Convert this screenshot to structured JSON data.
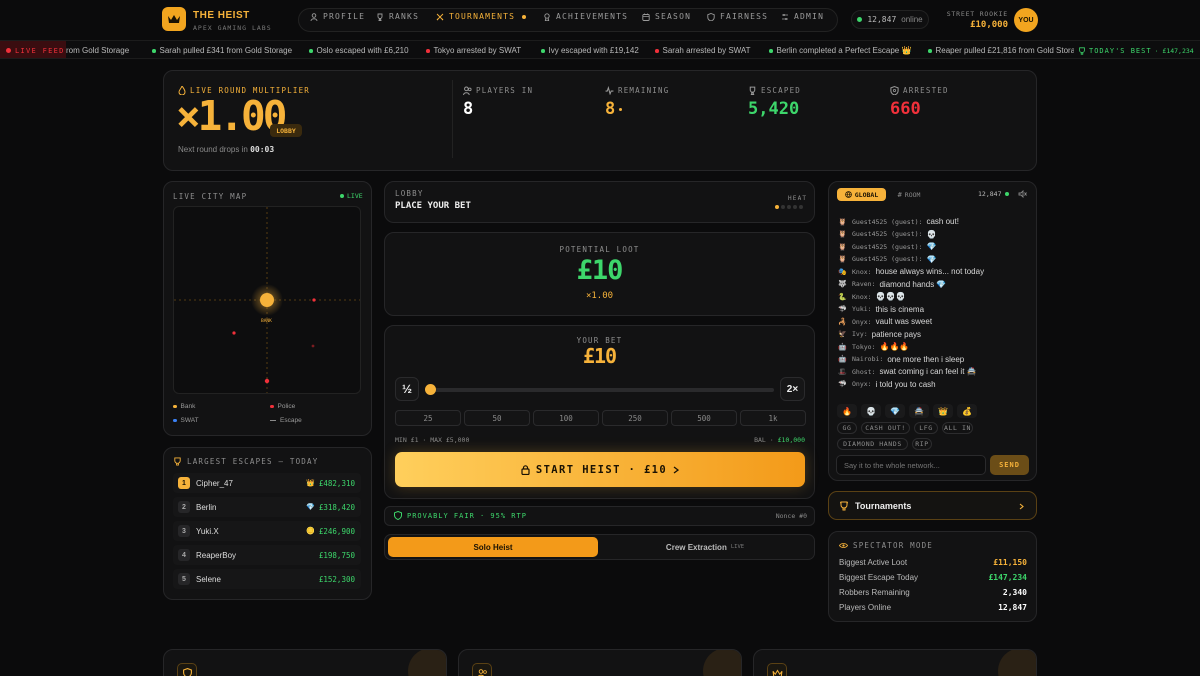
{
  "brand": {
    "name": "THE HEIST",
    "sub": "APEX GAMING LABS"
  },
  "nav": [
    {
      "label": "PROFILE",
      "icon": "user-icon"
    },
    {
      "label": "RANKS",
      "icon": "trophy-icon"
    },
    {
      "label": "TOURNAMENTS",
      "icon": "swords-icon",
      "active": true
    },
    {
      "label": "ACHIEVEMENTS",
      "icon": "medal-icon"
    },
    {
      "label": "SEASON",
      "icon": "calendar-icon"
    },
    {
      "label": "FAIRNESS",
      "icon": "shield-icon"
    },
    {
      "label": "ADMIN",
      "icon": "sliders-icon"
    }
  ],
  "online": {
    "count": "12,847",
    "label": "online"
  },
  "user": {
    "rank": "STREET ROOKIE",
    "balance": "£10,000",
    "avatar": "YOU"
  },
  "ticker": {
    "badge": "LIVE FEED",
    "items": [
      {
        "text": "rom Gold Storage",
        "color": "#b9b9b9"
      },
      {
        "text": "Sarah pulled £341 from Gold Storage",
        "color": "#3dd66b"
      },
      {
        "text": "Oslo escaped with £6,210",
        "color": "#3dd66b"
      },
      {
        "text": "Tokyo arrested by SWAT",
        "color": "#f0303a"
      },
      {
        "text": "Ivy escaped with £19,142",
        "color": "#3dd66b"
      },
      {
        "text": "Sarah arrested by SWAT",
        "color": "#f0303a"
      },
      {
        "text": "Berlin completed a Perfect Escape 👑",
        "color": "#3dd66b"
      },
      {
        "text": "Reaper pulled £21,816 from Gold Storag",
        "color": "#3dd66b"
      }
    ],
    "best_label": "TODAY'S BEST",
    "best_value": "· £147,234"
  },
  "round": {
    "label": "LIVE ROUND MULTIPLIER",
    "multiplier": "×1.00",
    "status": "LOBBY",
    "next_prefix": "Next round drops in",
    "next_time": "00:03"
  },
  "stats": [
    {
      "label": "PLAYERS IN",
      "value": "8",
      "icon": "users-icon",
      "color": "#ffffff"
    },
    {
      "label": "REMAINING",
      "value": "8",
      "icon": "pulse-icon",
      "color": "#f6b23a"
    },
    {
      "label": "ESCAPED",
      "value": "5,420",
      "icon": "trophy-icon",
      "color": "#3dd66b"
    },
    {
      "label": "ARRESTED",
      "value": "660",
      "icon": "badge-icon",
      "color": "#f0303a"
    }
  ],
  "map": {
    "title": "LIVE CITY MAP",
    "live": "LIVE",
    "bank_label": "BANK",
    "legend": [
      {
        "label": "Bank",
        "color": "#f6b23a"
      },
      {
        "label": "Police",
        "color": "#f0303a"
      },
      {
        "label": "SWAT",
        "color": "#3b82f6"
      },
      {
        "label": "Escape",
        "color": "#8a8a8a"
      }
    ]
  },
  "escapes": {
    "title": "LARGEST ESCAPES — TODAY",
    "rows": [
      {
        "rank": "1",
        "name": "Cipher_47",
        "icon": "👑",
        "amount": "£482,310"
      },
      {
        "rank": "2",
        "name": "Berlin",
        "icon": "💎",
        "amount": "£318,420"
      },
      {
        "rank": "3",
        "name": "Yuki.X",
        "icon": "🪙",
        "amount": "£246,900"
      },
      {
        "rank": "4",
        "name": "ReaperBoy",
        "icon": "",
        "amount": "£198,750"
      },
      {
        "rank": "5",
        "name": "Selene",
        "icon": "",
        "amount": "£152,300"
      }
    ]
  },
  "lobby": {
    "label": "LOBBY",
    "title": "PLACE YOUR BET",
    "heat": "HEAT"
  },
  "loot": {
    "label": "POTENTIAL LOOT",
    "value": "£10",
    "mult": "×1.00"
  },
  "bet": {
    "label": "YOUR BET",
    "value": "£10",
    "half": "½",
    "double": "2×",
    "slider_fraction": 0.0,
    "presets": [
      "25",
      "50",
      "100",
      "250",
      "500",
      "1k"
    ],
    "limits": "MIN £1 · MAX £5,000",
    "bal_label": "BAL ·",
    "bal_value": "£10,000",
    "cta": "START HEIST · £10"
  },
  "fair": {
    "label": "PROVABLY FAIR · 95% RTP",
    "nonce": "Nonce #0"
  },
  "modes": {
    "solo": "Solo Heist",
    "crew": "Crew Extraction",
    "crew_badge": "LIVE"
  },
  "chat": {
    "tabs": [
      "GLOBAL",
      "ROOM"
    ],
    "count": "12,847",
    "messages": [
      {
        "avatar": "🦉",
        "user": "Guest4525 (guest):",
        "text": "cash out!"
      },
      {
        "avatar": "🦉",
        "user": "Guest4525 (guest):",
        "text": "💀"
      },
      {
        "avatar": "🦉",
        "user": "Guest4525 (guest):",
        "text": "💎"
      },
      {
        "avatar": "🦉",
        "user": "Guest4525 (guest):",
        "text": "💎"
      },
      {
        "avatar": "🎭",
        "user": "Knox:",
        "text": "house always wins... not today"
      },
      {
        "avatar": "🐺",
        "user": "Raven:",
        "text": "diamond hands 💎"
      },
      {
        "avatar": "🐍",
        "user": "Knox:",
        "text": "💀💀💀"
      },
      {
        "avatar": "🦈",
        "user": "Yuki:",
        "text": "this is cinema"
      },
      {
        "avatar": "🦂",
        "user": "Onyx:",
        "text": "vault was sweet"
      },
      {
        "avatar": "🦅",
        "user": "Ivy:",
        "text": "patience pays"
      },
      {
        "avatar": "🤖",
        "user": "Tokyo:",
        "text": "🔥🔥🔥"
      },
      {
        "avatar": "🤖",
        "user": "Nairobi:",
        "text": "one more then i sleep"
      },
      {
        "avatar": "🎩",
        "user": "Ghost:",
        "text": "swat coming i can feel it 🚔"
      },
      {
        "avatar": "🦈",
        "user": "Onyx:",
        "text": "i told you to cash"
      }
    ],
    "emojis": [
      "🔥",
      "💀",
      "💎",
      "🚔",
      "👑",
      "💰"
    ],
    "quick": [
      "GG",
      "CASH OUT!",
      "LFG",
      "ALL IN",
      "DIAMOND HANDS",
      "RIP"
    ],
    "placeholder": "Say it to the whole network...",
    "send": "SEND"
  },
  "tournaments": {
    "label": "Tournaments"
  },
  "spectator": {
    "title": "SPECTATOR MODE",
    "rows": [
      {
        "label": "Biggest Active Loot",
        "value": "£11,150",
        "color": "#f6b23a"
      },
      {
        "label": "Biggest Escape Today",
        "value": "£147,234",
        "color": "#3dd66b"
      },
      {
        "label": "Robbers Remaining",
        "value": "2,340",
        "color": "#ffffff"
      },
      {
        "label": "Players Online",
        "value": "12,847",
        "color": "#ffffff"
      }
    ]
  }
}
